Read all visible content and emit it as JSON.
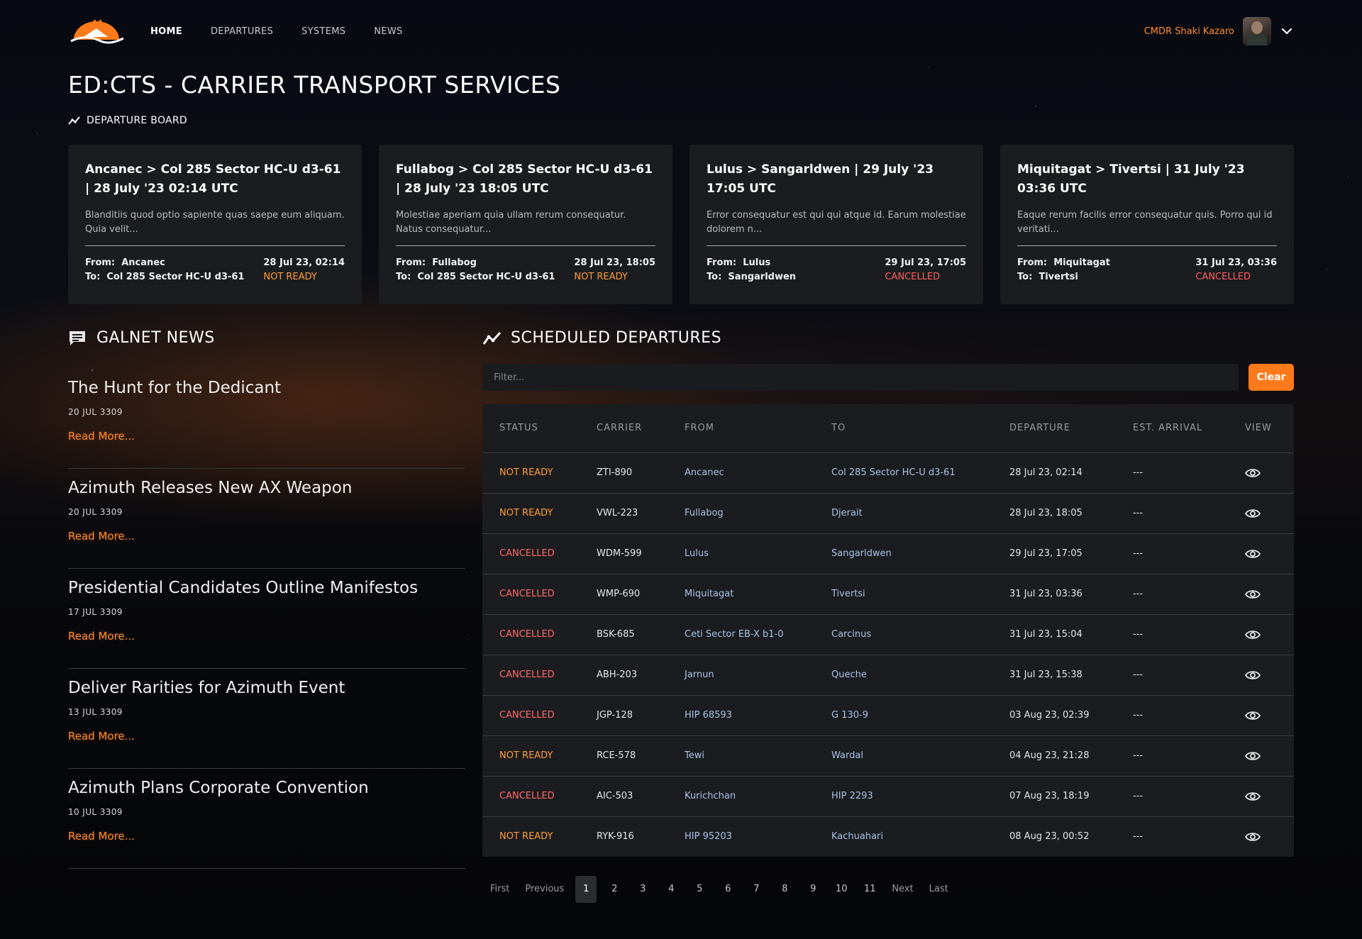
{
  "nav": {
    "links": [
      "HOME",
      "DEPARTURES",
      "SYSTEMS",
      "NEWS"
    ],
    "active": "HOME",
    "user_name": "CMDR Shaki Kazaro",
    "icons": {
      "logo": "carrier-logo",
      "menu": "chevron-down-icon",
      "avatar": "commander-avatar"
    }
  },
  "page_title": "ED:CTS - CARRIER TRANSPORT SERVICES",
  "departure_board": {
    "label": "DEPARTURE BOARD",
    "cards": [
      {
        "title": "Ancanec > Col 285 Sector HC-U d3-61 | 28 July '23 02:14 UTC",
        "description": "Blanditiis quod optio sapiente quas saepe eum aliquam. Quia velit...",
        "from_label": "From:",
        "from": "Ancanec",
        "to_label": "To:",
        "to": "Col 285 Sector HC-U d3-61",
        "departure": "28 Jul 23, 02:14",
        "status": "NOT READY"
      },
      {
        "title": "Fullabog > Col 285 Sector HC-U d3-61 | 28 July '23 18:05 UTC",
        "description": "Molestiae aperiam quia ullam rerum consequatur. Natus consequatur...",
        "from_label": "From:",
        "from": "Fullabog",
        "to_label": "To:",
        "to": "Col 285 Sector HC-U d3-61",
        "departure": "28 Jul 23, 18:05",
        "status": "NOT READY"
      },
      {
        "title": "Lulus > Sangarldwen | 29 July '23 17:05 UTC",
        "description": "Error consequatur est qui qui atque id. Earum molestiae dolorem n...",
        "from_label": "From:",
        "from": "Lulus",
        "to_label": "To:",
        "to": "Sangarldwen",
        "departure": "29 Jul 23, 17:05",
        "status": "CANCELLED"
      },
      {
        "title": "Miquitagat > Tivertsi | 31 July '23 03:36 UTC",
        "description": "Eaque rerum facilis error consequatur quis. Porro qui id veritati...",
        "from_label": "From:",
        "from": "Miquitagat",
        "to_label": "To:",
        "to": "Tivertsi",
        "departure": "31 Jul 23, 03:36",
        "status": "CANCELLED"
      }
    ]
  },
  "galnet": {
    "heading": "GALNET NEWS",
    "read_more": "Read More...",
    "items": [
      {
        "title": "The Hunt for the Dedicant",
        "date": "20 JUL 3309"
      },
      {
        "title": "Azimuth Releases New AX Weapon",
        "date": "20 JUL 3309"
      },
      {
        "title": "Presidential Candidates Outline Manifestos",
        "date": "17 JUL 3309"
      },
      {
        "title": "Deliver Rarities for Azimuth Event",
        "date": "13 JUL 3309"
      },
      {
        "title": "Azimuth Plans Corporate Convention",
        "date": "10 JUL 3309"
      }
    ]
  },
  "scheduled": {
    "heading": "SCHEDULED DEPARTURES",
    "filter_placeholder": "Filter...",
    "clear_label": "Clear",
    "columns": [
      "STATUS",
      "CARRIER",
      "FROM",
      "TO",
      "DEPARTURE",
      "EST. ARRIVAL",
      "VIEW"
    ],
    "rows": [
      {
        "status": "NOT READY",
        "carrier": "ZTI-890",
        "from": "Ancanec",
        "to": "Col 285 Sector HC-U d3-61",
        "departure": "28 Jul 23, 02:14",
        "arrival": "---"
      },
      {
        "status": "NOT READY",
        "carrier": "VWL-223",
        "from": "Fullabog",
        "to": "Djerait",
        "departure": "28 Jul 23, 18:05",
        "arrival": "---"
      },
      {
        "status": "CANCELLED",
        "carrier": "WDM-599",
        "from": "Lulus",
        "to": "Sangarldwen",
        "departure": "29 Jul 23, 17:05",
        "arrival": "---"
      },
      {
        "status": "CANCELLED",
        "carrier": "WMP-690",
        "from": "Miquitagat",
        "to": "Tivertsi",
        "departure": "31 Jul 23, 03:36",
        "arrival": "---"
      },
      {
        "status": "CANCELLED",
        "carrier": "BSK-685",
        "from": "Ceti Sector EB-X b1-0",
        "to": "Carcinus",
        "departure": "31 Jul 23, 15:04",
        "arrival": "---"
      },
      {
        "status": "CANCELLED",
        "carrier": "ABH-203",
        "from": "Jarnun",
        "to": "Queche",
        "departure": "31 Jul 23, 15:38",
        "arrival": "---"
      },
      {
        "status": "CANCELLED",
        "carrier": "JGP-128",
        "from": "HIP 68593",
        "to": "G 130-9",
        "departure": "03 Aug 23, 02:39",
        "arrival": "---"
      },
      {
        "status": "NOT READY",
        "carrier": "RCE-578",
        "from": "Tewi",
        "to": "Wardal",
        "departure": "04 Aug 23, 21:28",
        "arrival": "---"
      },
      {
        "status": "CANCELLED",
        "carrier": "AIC-503",
        "from": "Kurichchan",
        "to": "HIP 2293",
        "departure": "07 Aug 23, 18:19",
        "arrival": "---"
      },
      {
        "status": "NOT READY",
        "carrier": "RYK-916",
        "from": "HIP 95203",
        "to": "Kachuahari",
        "departure": "08 Aug 23, 00:52",
        "arrival": "---"
      }
    ]
  },
  "pagination": {
    "first": "First",
    "previous": "Previous",
    "pages": [
      "1",
      "2",
      "3",
      "4",
      "5",
      "6",
      "7",
      "8",
      "9",
      "10",
      "11"
    ],
    "current": "1",
    "next": "Next",
    "last": "Last"
  },
  "colors": {
    "accent": "#ff7a1a",
    "not_ready": "#ff9d3a",
    "cancelled": "#ff6a6a",
    "link": "#a9c3ea",
    "panel": "#1b1c1f"
  }
}
